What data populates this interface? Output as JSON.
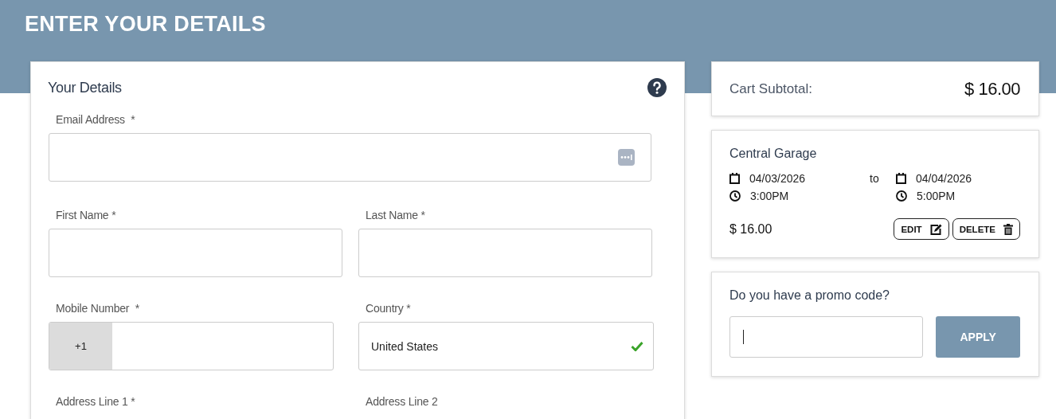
{
  "header": {
    "title": "ENTER YOUR DETAILS"
  },
  "details": {
    "title": "Your Details",
    "email": {
      "label": "Email Address  *"
    },
    "first_name": {
      "label": "First Name *"
    },
    "last_name": {
      "label": "Last Name *"
    },
    "mobile": {
      "label": "Mobile Number  *",
      "prefix": "+1"
    },
    "country": {
      "label": "Country *",
      "value": "United States",
      "valid": true
    },
    "address_1": {
      "label": "Address Line 1 *"
    },
    "address_2": {
      "label": "Address Line 2"
    }
  },
  "cart": {
    "label": "Cart Subtotal:",
    "total": "$ 16.00"
  },
  "booking": {
    "location": "Central Garage",
    "start_date": "04/03/2026",
    "separator": "to",
    "end_date": "04/04/2026",
    "start_time": "3:00PM",
    "end_time": "5:00PM",
    "price": "$ 16.00",
    "buttons": [
      "EDIT",
      "DELETE"
    ]
  },
  "promo": {
    "title": "Do you have a promo code?",
    "focused": true,
    "button": "APPLY"
  }
}
